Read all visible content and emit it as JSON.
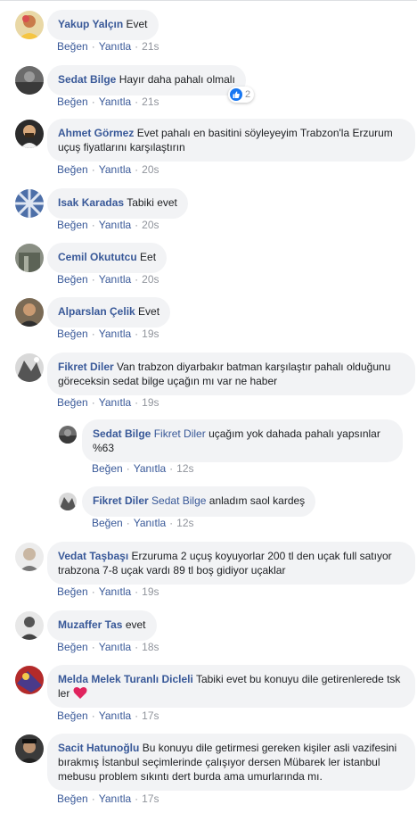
{
  "actions": {
    "like": "Beğen",
    "reply": "Yanıtla",
    "sep": "·"
  },
  "comments": [
    {
      "name": "Yakup Yalçın",
      "text": "Evet",
      "time": "21s"
    },
    {
      "name": "Sedat Bilge",
      "text": "Hayır daha pahalı olmalı",
      "time": "21s",
      "reaction_count": "2"
    },
    {
      "name": "Ahmet Görmez",
      "text": "Evet pahalı en basitini söyleyeyim Trabzon'la Erzurum uçuş fiyatlarını karşılaştırın",
      "time": "20s"
    },
    {
      "name": "Isak Karadas",
      "text": "Tabiki evet",
      "time": "20s"
    },
    {
      "name": "Cemil Okututcu",
      "text": "Eet",
      "time": "20s"
    },
    {
      "name": "Alparslan Çelik",
      "text": "Evet",
      "time": "19s"
    },
    {
      "name": "Fikret Diler",
      "text": "Van trabzon diyarbakır batman karşılaştır pahalı olduğunu göreceksin sedat bilge uçağın mı var ne haber",
      "time": "19s"
    },
    {
      "name": "Sedat Bilge",
      "mention": "Fikret Diler",
      "text": "uçağım yok dahada pahalı yapsınlar %63",
      "time": "12s"
    },
    {
      "name": "Fikret Diler",
      "mention": "Sedat Bilge",
      "text": "anladım saol kardeş",
      "time": "12s"
    },
    {
      "name": "Vedat Taşbaşı",
      "text": "Erzuruma 2 uçuş koyuyorlar 200 tl den uçak full satıyor trabzona 7-8 uçak vardı 89 tl boş gidiyor uçaklar",
      "time": "19s"
    },
    {
      "name": "Muzaffer Tas",
      "text": "evet",
      "time": "18s"
    },
    {
      "name": "Melda Melek Turanlı Dicleli",
      "text": "Tabiki evet bu konuyu dile getirenlerede tsk ler",
      "time": "17s"
    },
    {
      "name": "Sacit Hatunoğlu",
      "text": "Bu konuyu dile getirmesi gereken kişiler asli vazifesini bırakmış İstanbul seçimlerinde çalışıyor dersen Mübarek ler istanbul mebusu problem sıkıntı dert burda ama umurlarında mı.",
      "time": "17s"
    }
  ],
  "colors": {
    "name": "#385898",
    "bubble": "#f2f3f5",
    "like": "#1877f2",
    "heart": "#e0245e"
  },
  "icons": {
    "reaction": "thumbs-up-icon",
    "emoji": "heart-icon"
  }
}
